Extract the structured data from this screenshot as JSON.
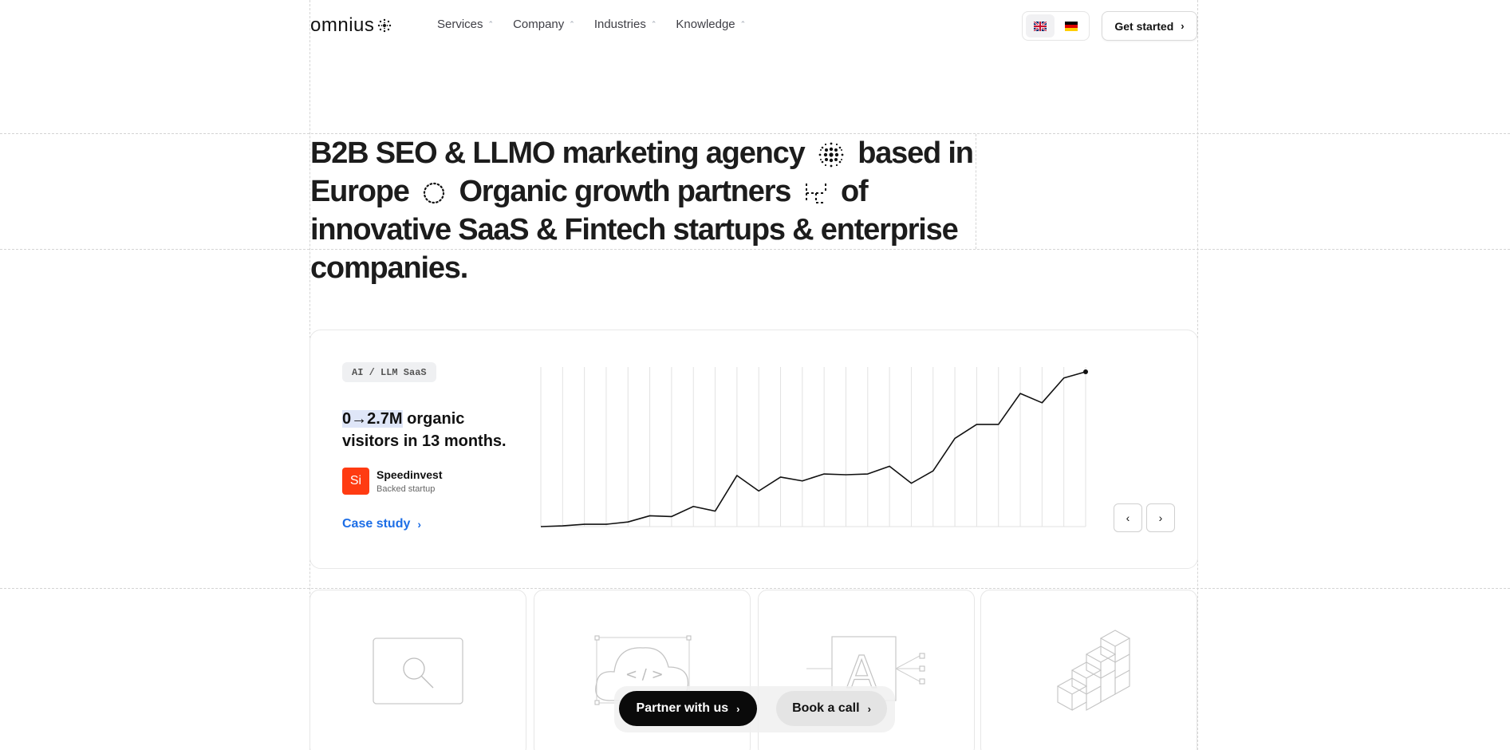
{
  "nav": {
    "logo_text": "omnius",
    "menu": [
      {
        "label": "Services"
      },
      {
        "label": "Company"
      },
      {
        "label": "Industries"
      },
      {
        "label": "Knowledge"
      }
    ],
    "languages": [
      {
        "code": "en",
        "icon": "uk-flag-icon",
        "active": true
      },
      {
        "code": "de",
        "icon": "germany-flag-icon",
        "active": false
      }
    ],
    "get_started": "Get started"
  },
  "hero": {
    "part1": "B2B SEO & LLMO marketing agency",
    "part2": "based in Europe",
    "part3": "Organic growth partners",
    "part4": "of innovative SaaS & Fintech startups & enterprise companies."
  },
  "case_study": {
    "tag": "AI / LLM SaaS",
    "highlight": "0→2.7M",
    "headline_rest": " organic visitors in 13 months.",
    "company_initials": "Si",
    "company_name": "Speedinvest",
    "company_sub": "Backed startup",
    "link_label": "Case study",
    "accent_color": "#1d6ee6",
    "brand_color": "#ff3b12"
  },
  "chart_data": {
    "type": "line",
    "title": "",
    "xlabel": "",
    "ylabel": "",
    "ylim": [
      0,
      100
    ],
    "grid": "vertical",
    "values": [
      0,
      0.5,
      1.5,
      1.5,
      3,
      7,
      6.5,
      13,
      10,
      33,
      23,
      32,
      29.5,
      34,
      33.5,
      34,
      39,
      28,
      36,
      57,
      66,
      66,
      86,
      80,
      96,
      100
    ]
  },
  "ctas": {
    "partner": "Partner with us",
    "book": "Book a call"
  },
  "services": [
    {
      "icon": "search-window-icon"
    },
    {
      "icon": "cloud-code-icon"
    },
    {
      "icon": "text-a-network-icon"
    },
    {
      "icon": "cubes-stack-icon"
    }
  ]
}
